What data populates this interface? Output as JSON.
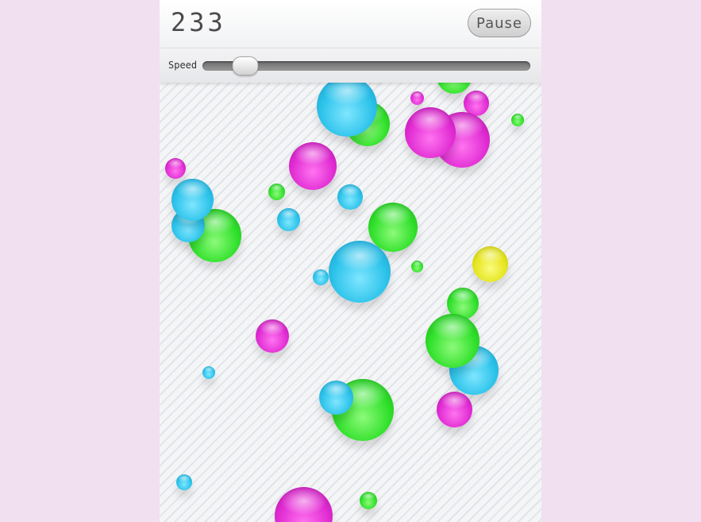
{
  "score": "233",
  "pause_label": "Pause",
  "speed": {
    "label": "Speed",
    "value": 0.1
  },
  "colors": {
    "cyan": "#2bc2ea",
    "green": "#2fe02a",
    "magenta": "#e12cd3",
    "yellow": "#e5e51e",
    "page_background": "#f1e0f0"
  },
  "bubble_color_counts": {
    "cyan": 11,
    "green": 13,
    "magenta": 11,
    "yellow": 1
  }
}
